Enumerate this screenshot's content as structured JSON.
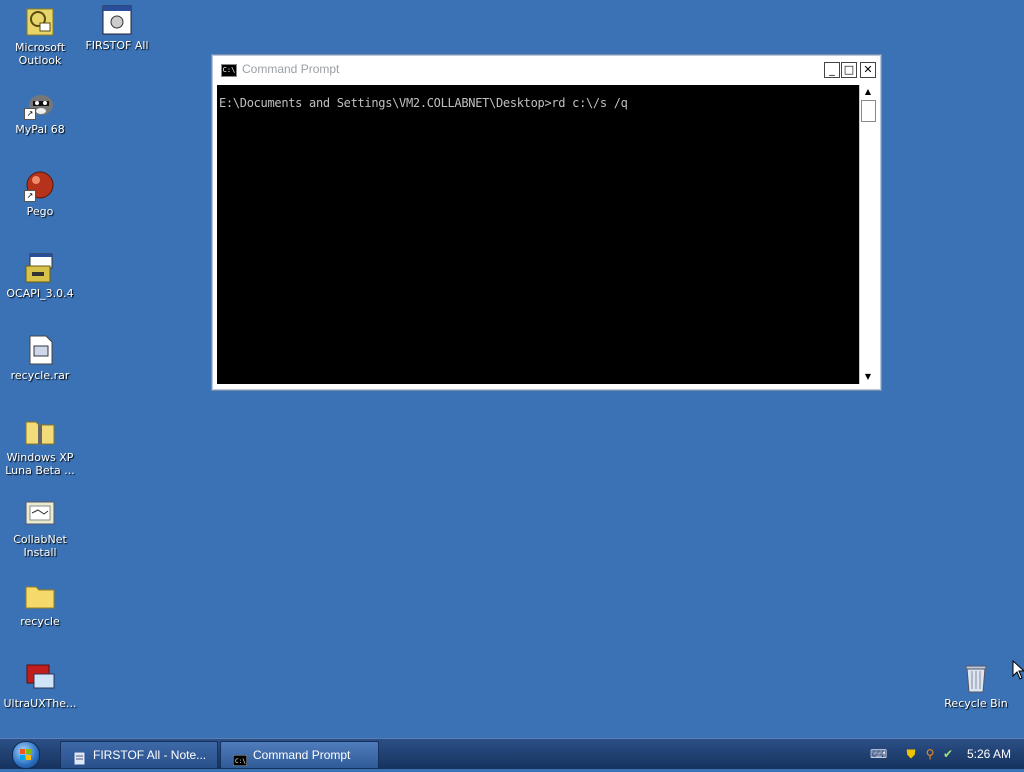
{
  "desktop": {
    "icons": [
      {
        "label": "Microsoft Outlook"
      },
      {
        "label": "FIRSTOF All"
      },
      {
        "label": "MyPal 68"
      },
      {
        "label": "Pego"
      },
      {
        "label": "OCAPI_3.0.4"
      },
      {
        "label": "recycle.rar"
      },
      {
        "label": "Windows XP Luna Beta ..."
      },
      {
        "label": "CollabNet Install"
      },
      {
        "label": "recycle"
      },
      {
        "label": "UltraUXThe..."
      },
      {
        "label": "Recycle Bin"
      }
    ]
  },
  "window": {
    "title": "Command Prompt",
    "icon_text": "C:\\",
    "minimize_glyph": "_",
    "maximize_glyph": "□",
    "close_glyph": "✕",
    "console_line": "E:\\Documents and Settings\\VM2.COLLABNET\\Desktop>rd c:\\/s /q"
  },
  "taskbar": {
    "buttons": [
      {
        "label": "FIRSTOF All - Note..."
      },
      {
        "label": "Command Prompt"
      }
    ],
    "clock": "5:26 AM"
  },
  "colors": {
    "desktop_background": "#3a72b5",
    "console_background": "#000000",
    "console_text": "#c0c0c0"
  }
}
